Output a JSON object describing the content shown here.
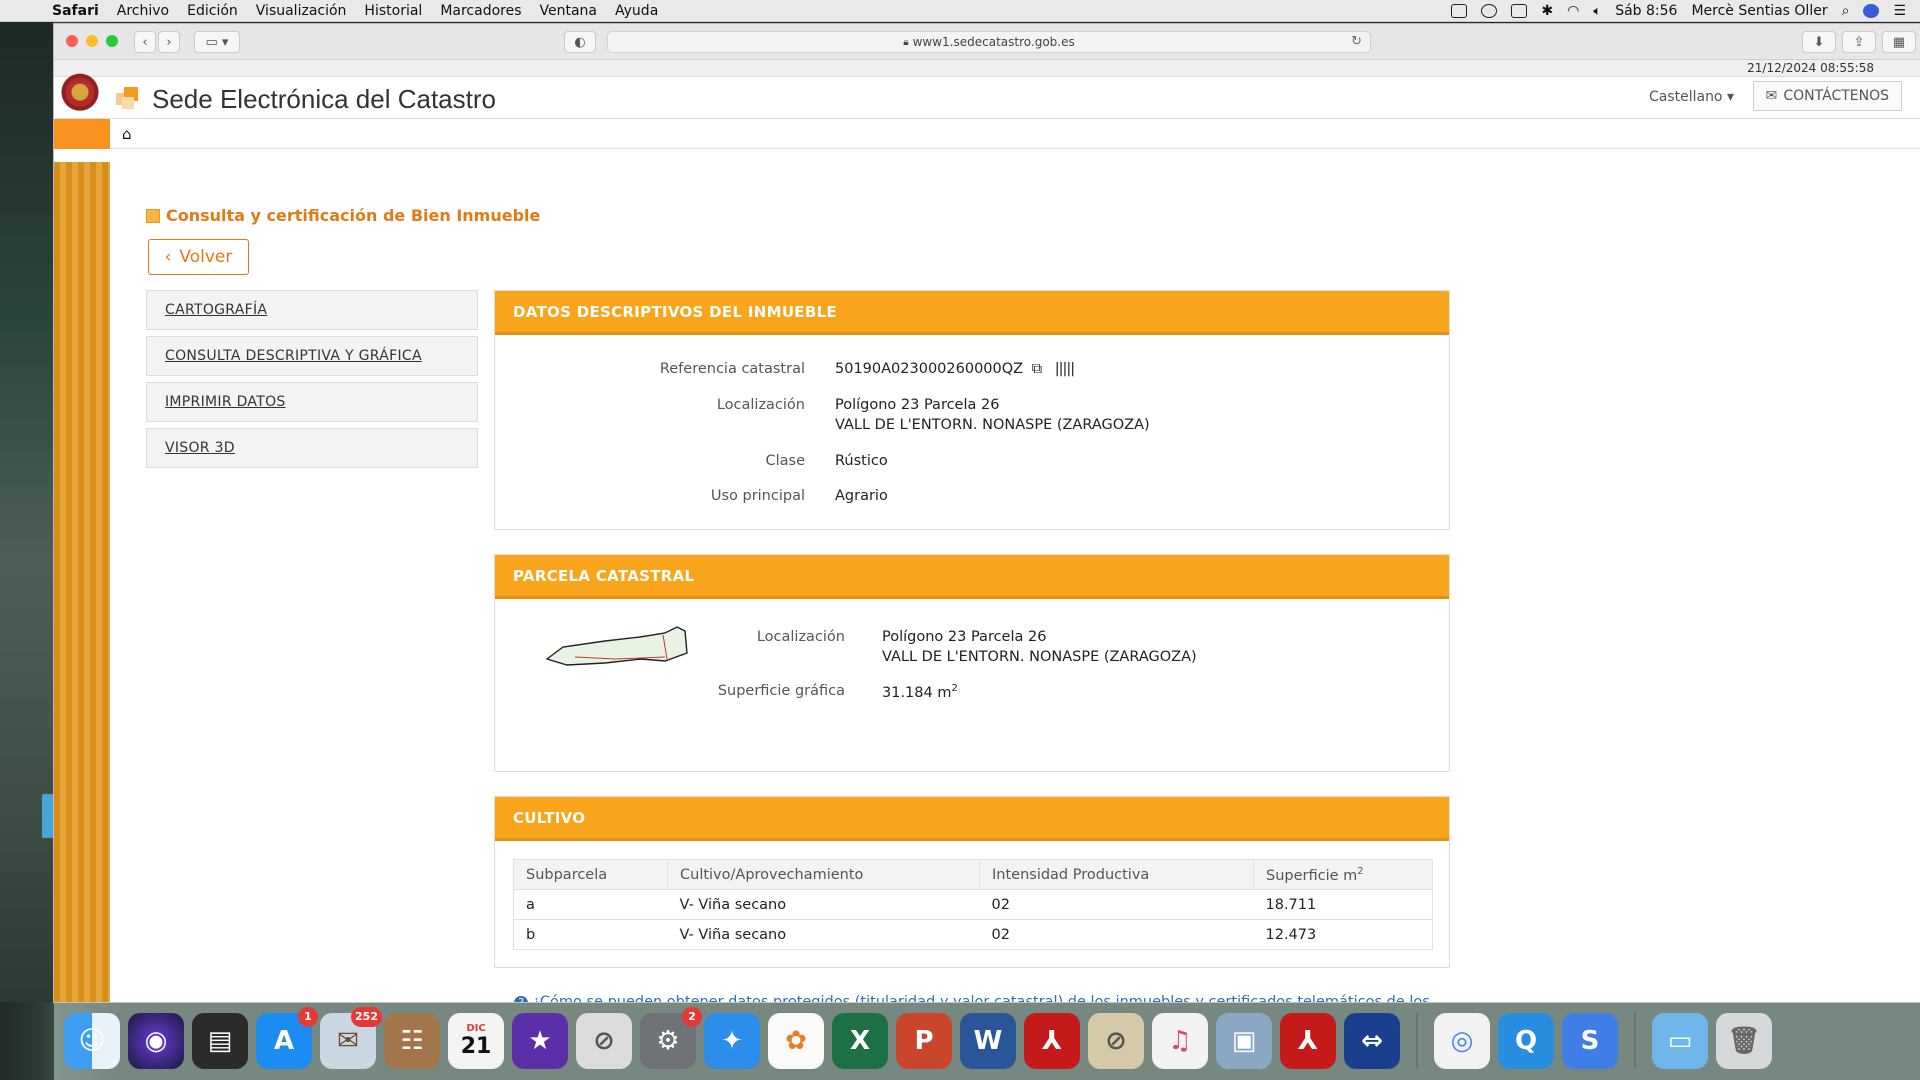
{
  "menubar": {
    "app": "Safari",
    "items": [
      "Archivo",
      "Edición",
      "Visualización",
      "Historial",
      "Marcadores",
      "Ventana",
      "Ayuda"
    ],
    "clock": "Sáb 8:56",
    "user": "Mercè Sentias Oller"
  },
  "browser": {
    "url": "www1.sedecatastro.gob.es"
  },
  "site": {
    "datetime": "21/12/2024  08:55:58",
    "title": "Sede Electrónica del Catastro",
    "language": "Castellano",
    "contact": "CONTÁCTENOS"
  },
  "page": {
    "section_title": "Consulta y certificación de Bien Inmueble",
    "back_label": "Volver",
    "side_menu": [
      "CARTOGRAFÍA",
      "CONSULTA DESCRIPTIVA Y GRÁFICA",
      "IMPRIMIR DATOS",
      "VISOR 3D"
    ]
  },
  "datos": {
    "heading": "DATOS DESCRIPTIVOS DEL INMUEBLE",
    "ref_label": "Referencia catastral",
    "ref_value": "50190A023000260000QZ",
    "loc_label": "Localización",
    "loc_line1": "Polígono 23 Parcela 26",
    "loc_line2": "VALL DE L'ENTORN. NONASPE (ZARAGOZA)",
    "clase_label": "Clase",
    "clase_value": "Rústico",
    "uso_label": "Uso principal",
    "uso_value": "Agrario"
  },
  "parcela": {
    "heading": "PARCELA CATASTRAL",
    "loc_label": "Localización",
    "loc_line1": "Polígono 23 Parcela 26",
    "loc_line2": "VALL DE L'ENTORN. NONASPE (ZARAGOZA)",
    "sup_label": "Superficie gráfica",
    "sup_value": "31.184 m",
    "sup_unit_sup": "2"
  },
  "cultivo": {
    "heading": "CULTIVO",
    "columns": [
      "Subparcela",
      "Cultivo/Aprovechamiento",
      "Intensidad Productiva",
      "Superficie m"
    ],
    "col_sup": "2",
    "rows": [
      [
        "a",
        "V- Viña secano",
        "02",
        "18.711"
      ],
      [
        "b",
        "V- Viña secano",
        "02",
        "12.473"
      ]
    ]
  },
  "help_link": "¿Cómo se pueden obtener datos protegidos (titularidad y valor catastral) de los inmuebles y certificados telemáticos de los mismos?",
  "dock": {
    "badges": {
      "appstore": "1",
      "mail": "252",
      "prefs": "2"
    },
    "calendar_month": "DIC",
    "calendar_day": "21"
  }
}
